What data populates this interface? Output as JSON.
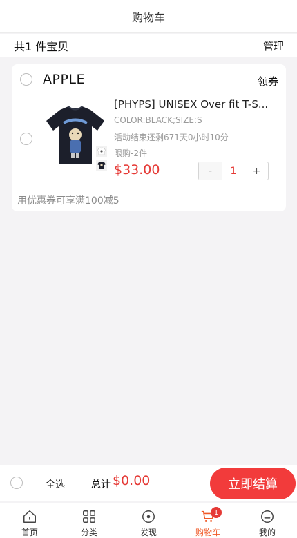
{
  "header": {
    "title": "购物车"
  },
  "summary": {
    "count_text": "共1 件宝贝",
    "manage_label": "管理"
  },
  "store": {
    "name": "APPLE",
    "coupon_label": "领券",
    "item": {
      "title": "[PHYPS] UNISEX Over fit T-S...",
      "spec": "COLOR:BLACK;SIZE:S",
      "time_left": "活动结束还剩671天0小时10分",
      "limit": "限购-2件",
      "price": "$33.00",
      "quantity": "1",
      "minus_label": "-",
      "plus_label": "+",
      "product_icon": "black-tshirt-image"
    },
    "promo_text": "用优惠券可享满100减5"
  },
  "checkout": {
    "select_all_label": "全选",
    "total_label": "总计",
    "total_value": "$0.00",
    "checkout_label": "立即结算"
  },
  "tabs": [
    {
      "label": "首页",
      "icon": "home-icon",
      "active": false
    },
    {
      "label": "分类",
      "icon": "grid-icon",
      "active": false
    },
    {
      "label": "发现",
      "icon": "compass-icon",
      "active": false
    },
    {
      "label": "购物车",
      "icon": "cart-icon",
      "active": true,
      "badge": "1"
    },
    {
      "label": "我的",
      "icon": "user-icon",
      "active": false
    }
  ],
  "colors": {
    "accent": "#e53935",
    "checkout_button": "#f23b3b",
    "active_tab": "#f05a28",
    "background": "#f4f3f5"
  }
}
